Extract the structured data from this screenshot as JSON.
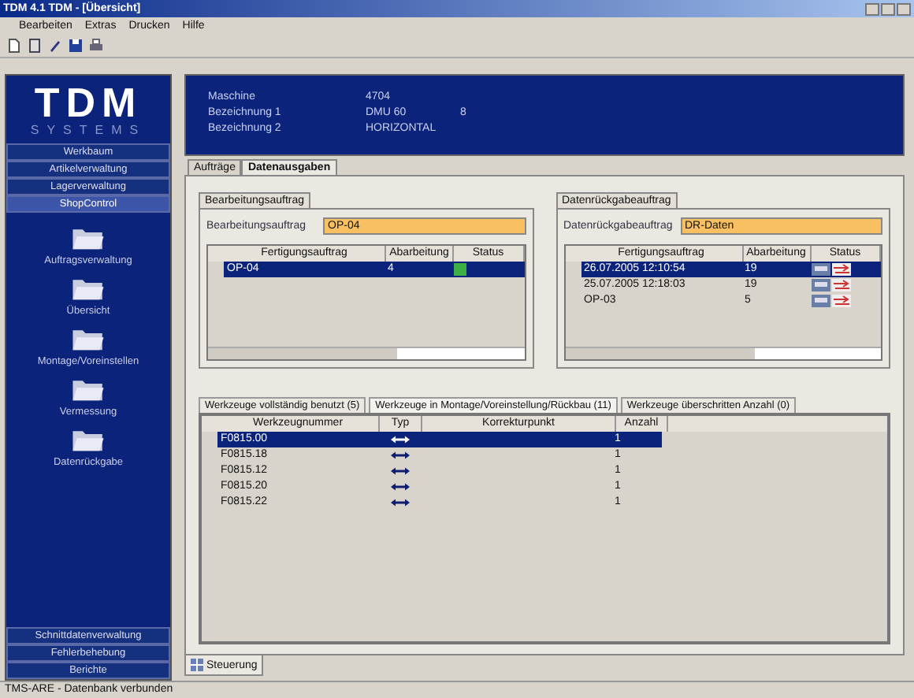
{
  "window": {
    "title": "TDM 4.1 TDM - [Übersicht]"
  },
  "menu": [
    "Bearbeiten",
    "Extras",
    "Drucken",
    "Hilfe"
  ],
  "sidebar": {
    "logo": "TDM",
    "logo_sub": "SYSTEMS",
    "top_items": [
      {
        "label": "Werkbaum",
        "selected": false
      },
      {
        "label": "Artikelverwaltung",
        "selected": false
      },
      {
        "label": "Lagerverwaltung",
        "selected": false
      },
      {
        "label": "ShopControl",
        "selected": true
      }
    ],
    "tools": [
      "Auftragsverwaltung",
      "Übersicht",
      "Montage/Voreinstellen",
      "Vermessung",
      "Datenrückgabe"
    ],
    "bottom_items": [
      "Schnittdatenverwaltung",
      "Fehlerbehebung",
      "Berichte"
    ]
  },
  "header": [
    {
      "label": "Maschine",
      "value": "4704"
    },
    {
      "label": "Bezeichnung 1",
      "value": "DMU 60",
      "extra": "8"
    },
    {
      "label": "Bezeichnung 2",
      "value": "HORIZONTAL"
    }
  ],
  "tabs": [
    {
      "label": "Aufträge",
      "selected": false
    },
    {
      "label": "Datenausgaben",
      "selected": true
    }
  ],
  "left_group": {
    "title": "Bearbeitungsauftrag",
    "field_label": "Bearbeitungsauftrag",
    "field_value": "OP-04",
    "columns": [
      "Fertigungsauftrag",
      "Abarbeitung",
      "Status"
    ],
    "rows": [
      {
        "cells": [
          "OP-04",
          "4"
        ],
        "selected": true,
        "color": "#3cb043"
      }
    ]
  },
  "right_group": {
    "title": "Datenrückgabeauftrag",
    "field_label": "Datenrückgabeauftrag",
    "field_value": "DR-Daten",
    "columns": [
      "Fertigungsauftrag",
      "Abarbeitung",
      "Status"
    ],
    "rows": [
      {
        "cells": [
          "26.07.2005 12:10:54",
          "19"
        ],
        "selected": true
      },
      {
        "cells": [
          "25.07.2005 12:18:03",
          "19"
        ],
        "selected": false
      },
      {
        "cells": [
          "OP-03",
          "5"
        ],
        "selected": false
      }
    ]
  },
  "bottom_tabs": [
    {
      "label": "Werkzeuge vollständig benutzt (5)",
      "selected": false
    },
    {
      "label": "Werkzeuge in Montage/Voreinstellung/Rückbau (11)",
      "selected": true
    },
    {
      "label": "Werkzeuge überschritten Anzahl (0)",
      "selected": false
    }
  ],
  "tool_table": {
    "columns": [
      "Werkzeugnummer",
      "Typ",
      "Korrekturpunkt",
      "Anzahl"
    ],
    "rows": [
      {
        "cells": [
          "F0815.00",
          "1"
        ],
        "selected": true
      },
      {
        "cells": [
          "F0815.18",
          "1"
        ],
        "selected": false
      },
      {
        "cells": [
          "F0815.12",
          "1"
        ],
        "selected": false
      },
      {
        "cells": [
          "F0815.20",
          "1"
        ],
        "selected": false
      },
      {
        "cells": [
          "F0815.22",
          "1"
        ],
        "selected": false
      }
    ]
  },
  "window_tab": "Steuerung",
  "status_bar": "TMS-ARE - Datenbank verbunden"
}
